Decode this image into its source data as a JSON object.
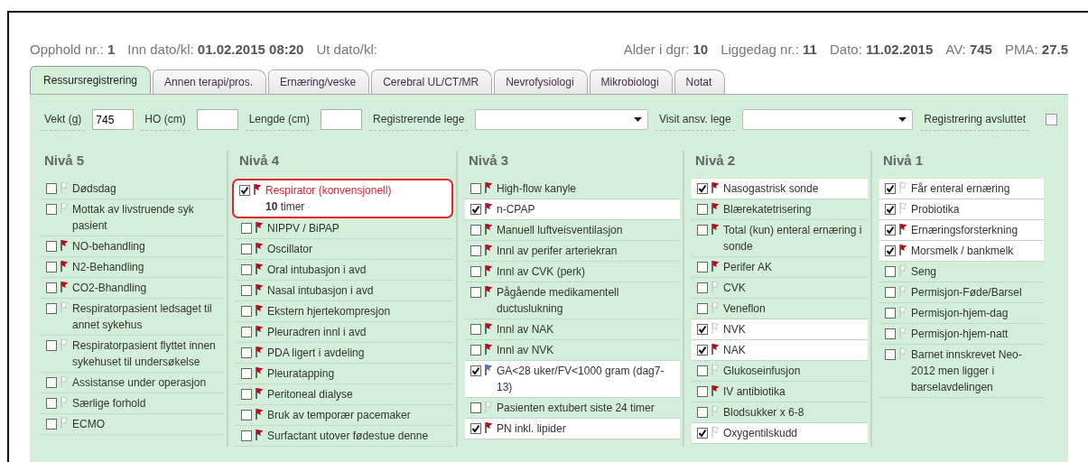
{
  "header": {
    "left": [
      "Opphold nr.: **1**",
      "Inn dato/kl: **01.02.2015 08:20**",
      "Ut dato/kl:"
    ],
    "right": [
      "Alder i dgr: **10**",
      "Liggedag nr.: **11**",
      "Dato: **11.02.2015**",
      "AV: **745**",
      "PMA: **27.5**"
    ]
  },
  "tabs": [
    {
      "label": "Ressursregistrering",
      "selected": true
    },
    {
      "label": "Annen terapi/pros.",
      "selected": false
    },
    {
      "label": "Ernæring/veske",
      "selected": false
    },
    {
      "label": "Cerebral UL/CT/MR",
      "selected": false
    },
    {
      "label": "Nevrofysiologi",
      "selected": false
    },
    {
      "label": "Mikrobiologi",
      "selected": false
    },
    {
      "label": "Notat",
      "selected": false
    }
  ],
  "form": [
    {
      "kind": "text",
      "label": "Vekt (g)",
      "value": "745"
    },
    {
      "kind": "text",
      "label": "HO (cm)"
    },
    {
      "kind": "text",
      "label": "Lengde (cm)"
    },
    {
      "kind": "select",
      "label": "Registrerende lege"
    },
    {
      "kind": "select",
      "label": "Visit ansv. lege"
    },
    {
      "kind": "checkbox",
      "label": "Registrering avsluttet",
      "checked": false
    }
  ],
  "levels": [
    {
      "title": "Nivå 5",
      "items": [
        {
          "label": "Dødsdag",
          "checked": false,
          "selected": false,
          "kind": "outline"
        },
        {
          "label": "Mottak av livstruende syk pasient",
          "checked": false,
          "selected": false,
          "kind": "outline"
        },
        {
          "label": "NO-behandling",
          "checked": false,
          "selected": false,
          "kind": "filled",
          "color": "#c00018"
        },
        {
          "label": "N2-Behandling",
          "checked": false,
          "selected": false,
          "kind": "filled",
          "color": "#c00018"
        },
        {
          "label": "CO2-Bhandling",
          "checked": false,
          "selected": false,
          "kind": "filled",
          "color": "#c00018"
        },
        {
          "label": "Respiratorpasient ledsaget til annet sykehus",
          "checked": false,
          "selected": false,
          "kind": "outline"
        },
        {
          "label": "Respiratorpasient flyttet innen sykehuset til undersøkelse",
          "checked": false,
          "selected": false,
          "kind": "outline"
        },
        {
          "label": "Assistanse under operasjon",
          "checked": false,
          "selected": false,
          "kind": "outline"
        },
        {
          "label": "Særlige forhold",
          "checked": false,
          "selected": false,
          "kind": "outline"
        },
        {
          "label": "ECMO",
          "checked": false,
          "selected": false,
          "kind": "outline"
        }
      ]
    },
    {
      "title": "Nivå 4",
      "items": [
        {
          "label": "Respirator (konvensjonell)",
          "detail": "**10** timer",
          "checked": true,
          "selected": true,
          "kind": "filled",
          "color": "#c00018"
        },
        {
          "label": "NIPPV / BiPAP",
          "checked": false,
          "selected": false,
          "kind": "filled",
          "color": "#c00018"
        },
        {
          "label": "Oscillator",
          "checked": false,
          "selected": false,
          "kind": "filled",
          "color": "#c00018"
        },
        {
          "label": "Oral intubasjon i avd",
          "checked": false,
          "selected": false,
          "kind": "filled",
          "color": "#c00018"
        },
        {
          "label": "Nasal intubasjon i avd",
          "checked": false,
          "selected": false,
          "kind": "filled",
          "color": "#c00018"
        },
        {
          "label": "Ekstern hjertekompresjon",
          "checked": false,
          "selected": false,
          "kind": "filled",
          "color": "#c00018"
        },
        {
          "label": "Pleuradren innl i avd",
          "checked": false,
          "selected": false,
          "kind": "filled",
          "color": "#c00018"
        },
        {
          "label": "PDA ligert i avdeling",
          "checked": false,
          "selected": false,
          "kind": "filled",
          "color": "#c00018"
        },
        {
          "label": "Pleuratapping",
          "checked": false,
          "selected": false,
          "kind": "filled",
          "color": "#c00018"
        },
        {
          "label": "Peritoneal dialyse",
          "checked": false,
          "selected": false,
          "kind": "filled",
          "color": "#c00018"
        },
        {
          "label": "Bruk av temporær pacemaker",
          "checked": false,
          "selected": false,
          "kind": "filled",
          "color": "#c00018"
        },
        {
          "label": "Surfactant utover fødestue denne",
          "checked": false,
          "selected": false,
          "kind": "filled",
          "color": "#c00018"
        }
      ]
    },
    {
      "title": "Nivå 3",
      "items": [
        {
          "label": "High-flow kanyle",
          "checked": false,
          "selected": false,
          "kind": "filled",
          "color": "#c00018"
        },
        {
          "label": "n-CPAP",
          "checked": true,
          "selected": false,
          "kind": "filled",
          "color": "#c00018"
        },
        {
          "label": "Manuell luftveisventilasjon",
          "checked": false,
          "selected": false,
          "kind": "filled",
          "color": "#c00018"
        },
        {
          "label": "Innl av perifer arteriekran",
          "checked": false,
          "selected": false,
          "kind": "filled",
          "color": "#c00018"
        },
        {
          "label": "Innl av CVK (perk)",
          "checked": false,
          "selected": false,
          "kind": "filled",
          "color": "#c00018"
        },
        {
          "label": "Pågående medikamentell ductuslukning",
          "checked": false,
          "selected": false,
          "kind": "filled",
          "color": "#c00018"
        },
        {
          "label": "Innl av NAK",
          "checked": false,
          "selected": false,
          "kind": "filled",
          "color": "#c00018"
        },
        {
          "label": "Innl av NVK",
          "checked": false,
          "selected": false,
          "kind": "filled",
          "color": "#c00018"
        },
        {
          "label": "GA<28 uker/FV<1000 gram (dag7-13)",
          "checked": true,
          "selected": false,
          "kind": "filled",
          "color": "#4a78c8"
        },
        {
          "label": "Pasienten extubert siste 24 timer",
          "checked": false,
          "selected": false,
          "kind": "outline"
        },
        {
          "label": "PN inkl. lipider",
          "checked": true,
          "selected": false,
          "kind": "filled",
          "color": "#c00018"
        }
      ]
    },
    {
      "title": "Nivå 2",
      "items": [
        {
          "label": "Nasogastrisk sonde",
          "checked": true,
          "selected": false,
          "kind": "filled",
          "color": "#c00018"
        },
        {
          "label": "Blærekatetrisering",
          "checked": false,
          "selected": false,
          "kind": "filled",
          "color": "#c00018"
        },
        {
          "label": "Total (kun) enteral ernæring i sonde",
          "checked": false,
          "selected": false,
          "kind": "filled",
          "color": "#c00018"
        },
        {
          "label": "Perifer AK",
          "checked": false,
          "selected": false,
          "kind": "filled",
          "color": "#c00018"
        },
        {
          "label": "CVK",
          "checked": false,
          "selected": false,
          "kind": "outline"
        },
        {
          "label": "Veneflon",
          "checked": false,
          "selected": false,
          "kind": "outline"
        },
        {
          "label": "NVK",
          "checked": true,
          "selected": false,
          "kind": "outline"
        },
        {
          "label": "NAK",
          "checked": true,
          "selected": false,
          "kind": "filled",
          "color": "#c00018"
        },
        {
          "label": "Glukoseinfusjon",
          "checked": false,
          "selected": false,
          "kind": "outline"
        },
        {
          "label": "IV antibiotika",
          "checked": false,
          "selected": false,
          "kind": "filled",
          "color": "#c00018"
        },
        {
          "label": "Blodsukker x 6-8",
          "checked": false,
          "selected": false,
          "kind": "outline"
        },
        {
          "label": "Oxygentilskudd",
          "checked": true,
          "selected": false,
          "kind": "outline"
        }
      ]
    },
    {
      "title": "Nivå 1",
      "items": [
        {
          "label": "Får enteral ernæring",
          "checked": true,
          "selected": false,
          "kind": "outline"
        },
        {
          "label": "Probiotika",
          "checked": true,
          "selected": false,
          "kind": "outline"
        },
        {
          "label": "Ernæringsforsterkning",
          "checked": true,
          "selected": false,
          "kind": "filled",
          "color": "#c00018"
        },
        {
          "label": "Morsmelk / bankmelk",
          "checked": true,
          "selected": false,
          "kind": "filled",
          "color": "#c00018"
        },
        {
          "label": "Seng",
          "checked": false,
          "selected": false,
          "kind": "outline"
        },
        {
          "label": "Permisjon-Føde/Barsel",
          "checked": false,
          "selected": false,
          "kind": "outline"
        },
        {
          "label": "Permisjon-hjem-dag",
          "checked": false,
          "selected": false,
          "kind": "outline"
        },
        {
          "label": "Permisjon-hjem-natt",
          "checked": false,
          "selected": false,
          "kind": "outline"
        },
        {
          "label": "Barnet innskrevet Neo-2012 men ligger i barselavdelingen",
          "checked": false,
          "selected": false,
          "kind": "outline"
        }
      ]
    }
  ]
}
